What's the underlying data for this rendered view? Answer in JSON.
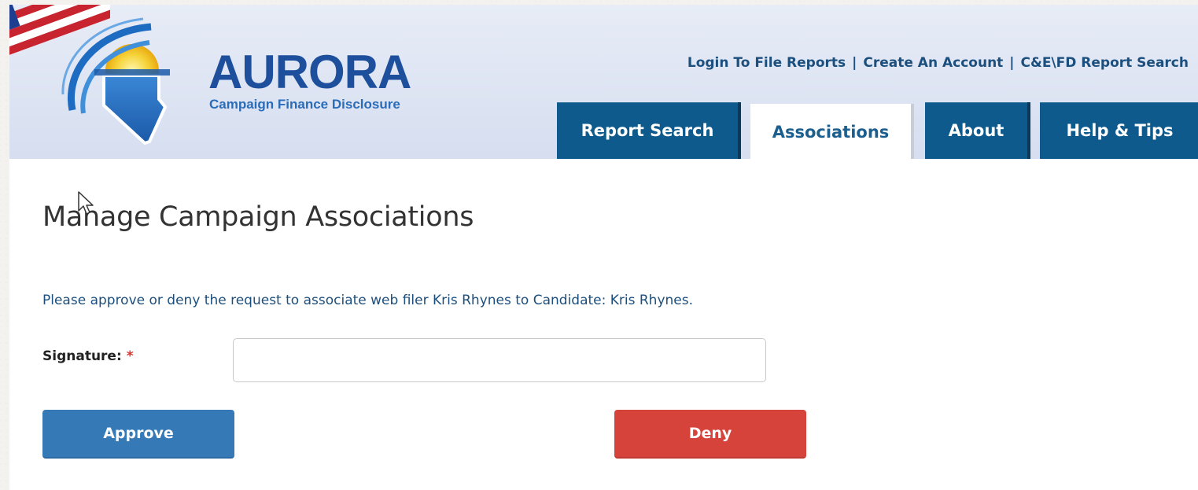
{
  "header": {
    "logo": {
      "word": "AURORA",
      "subtitle": "Campaign Finance Disclosure"
    },
    "top_links": [
      {
        "label": "Login To File Reports"
      },
      {
        "label": "Create An Account"
      },
      {
        "label": "C&E\\FD Report Search"
      }
    ],
    "separator": "|",
    "tabs": [
      {
        "label": "Report Search",
        "active": false
      },
      {
        "label": "Associations",
        "active": true
      },
      {
        "label": "About",
        "active": false
      },
      {
        "label": "Help & Tips",
        "active": false
      }
    ]
  },
  "main": {
    "title": "Manage Campaign Associations",
    "instruction": "Please approve or deny the request to associate web filer Kris Rhynes to Candidate: Kris Rhynes.",
    "signature": {
      "label": "Signature:",
      "required_mark": "*",
      "value": ""
    },
    "approve_label": "Approve",
    "deny_label": "Deny"
  },
  "colors": {
    "tab_bg": "#0e5a8c",
    "link": "#1c4f7d",
    "approve": "#357ab7",
    "deny": "#d6433b",
    "required": "#d9342b"
  }
}
